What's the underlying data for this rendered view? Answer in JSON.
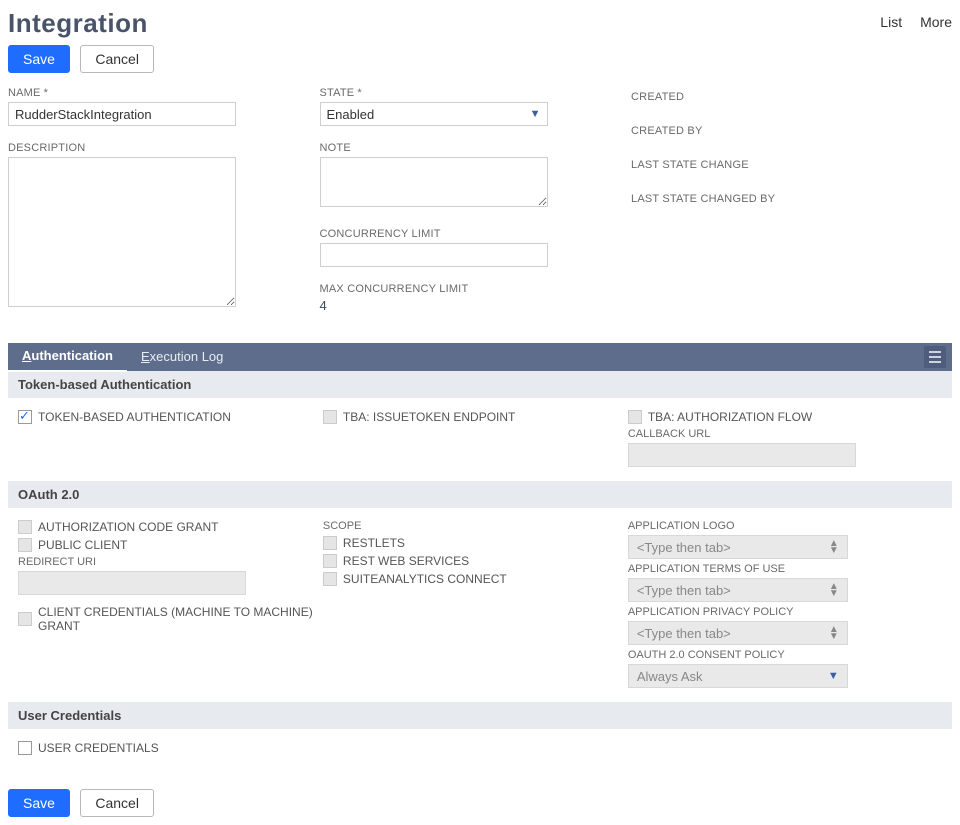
{
  "header": {
    "title": "Integration",
    "links": {
      "list": "List",
      "more": "More"
    }
  },
  "buttons": {
    "save": "Save",
    "cancel": "Cancel"
  },
  "fields": {
    "name": {
      "label": "NAME",
      "required": "*",
      "value": "RudderStackIntegration"
    },
    "description": {
      "label": "DESCRIPTION",
      "value": ""
    },
    "state": {
      "label": "STATE",
      "required": "*",
      "value": "Enabled"
    },
    "note": {
      "label": "NOTE",
      "value": ""
    },
    "concurrency_limit": {
      "label": "CONCURRENCY LIMIT",
      "value": ""
    },
    "max_concurrency": {
      "label": "MAX CONCURRENCY LIMIT",
      "value": "4"
    },
    "created": {
      "label": "CREATED"
    },
    "created_by": {
      "label": "CREATED BY"
    },
    "last_state_change": {
      "label": "LAST STATE CHANGE"
    },
    "last_state_changed_by": {
      "label": "LAST STATE CHANGED BY"
    }
  },
  "tabs": {
    "auth": "Authentication",
    "log": "Execution Log"
  },
  "sections": {
    "tba": {
      "title": "Token-based Authentication",
      "token_based": "TOKEN-BASED AUTHENTICATION",
      "issuetoken": "TBA: ISSUETOKEN ENDPOINT",
      "authflow": "TBA: AUTHORIZATION FLOW",
      "callback": "CALLBACK URL"
    },
    "oauth": {
      "title": "OAuth 2.0",
      "auth_code_grant": "AUTHORIZATION CODE GRANT",
      "public_client": "PUBLIC CLIENT",
      "redirect_uri": "REDIRECT URI",
      "client_credentials": "CLIENT CREDENTIALS (MACHINE TO MACHINE) GRANT",
      "scope": "SCOPE",
      "restlets": "RESTLETS",
      "rest_web": "REST WEB SERVICES",
      "suiteanalytics": "SUITEANALYTICS CONNECT",
      "app_logo": "APPLICATION LOGO",
      "app_terms": "APPLICATION TERMS OF USE",
      "app_privacy": "APPLICATION PRIVACY POLICY",
      "consent_policy": "OAUTH 2.0 CONSENT POLICY",
      "type_placeholder": "<Type then tab>",
      "consent_value": "Always Ask"
    },
    "user_creds": {
      "title": "User Credentials",
      "user_credentials": "USER CREDENTIALS"
    }
  }
}
